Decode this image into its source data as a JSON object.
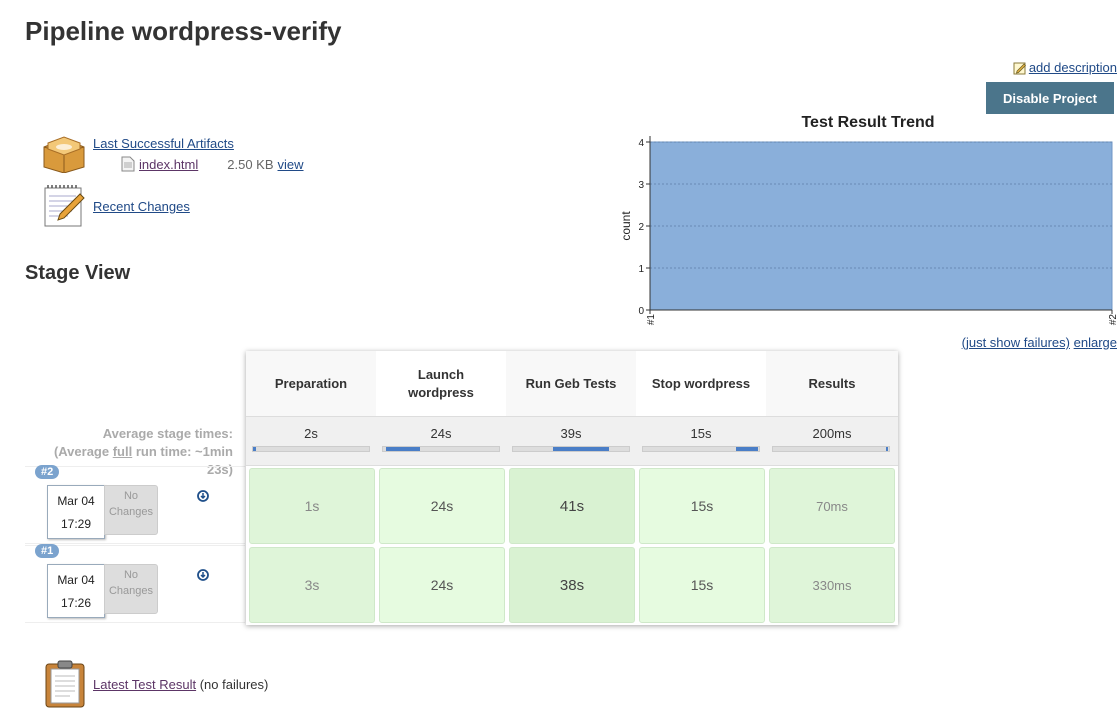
{
  "page": {
    "title": "Pipeline wordpress-verify"
  },
  "actions": {
    "add_description": "add description",
    "disable_project": "Disable Project"
  },
  "artifacts": {
    "label": "Last Successful Artifacts",
    "file": "index.html",
    "size": "2.50 KB",
    "view": "view"
  },
  "recent_changes": "Recent Changes",
  "stage_view": {
    "title": "Stage View",
    "avg_label_1": "Average stage times:",
    "avg_label_2a": "(Average ",
    "avg_label_full": "full",
    "avg_label_2b": " run time: ~1min",
    "avg_label_3": "23s)",
    "stages": [
      {
        "name": "Preparation",
        "avg": "2s"
      },
      {
        "name": "Launch wordpress",
        "avg": "24s"
      },
      {
        "name": "Run Geb Tests",
        "avg": "39s"
      },
      {
        "name": "Stop wordpress",
        "avg": "15s"
      },
      {
        "name": "Results",
        "avg": "200ms"
      }
    ],
    "builds": [
      {
        "id": "#2",
        "date": "Mar 04",
        "time": "17:29",
        "changes": "No Changes",
        "cells": [
          "1s",
          "24s",
          "41s",
          "15s",
          "70ms"
        ]
      },
      {
        "id": "#1",
        "date": "Mar 04",
        "time": "17:26",
        "changes": "No Changes",
        "cells": [
          "3s",
          "24s",
          "38s",
          "15s",
          "330ms"
        ]
      }
    ]
  },
  "chart_data": {
    "type": "area",
    "title": "Test Result Trend",
    "ylabel": "count",
    "x": [
      "#1",
      "#2"
    ],
    "ylim": [
      0,
      4
    ],
    "yticks": [
      "0",
      "1",
      "2",
      "3",
      "4"
    ],
    "series": [
      {
        "values": [
          4,
          4
        ],
        "color": "#8aafda"
      }
    ]
  },
  "chart_links": {
    "just_failures": "(just show failures)",
    "enlarge": "enlarge"
  },
  "latest_test": {
    "label": "Latest Test Result",
    "suffix": " (no failures)"
  }
}
